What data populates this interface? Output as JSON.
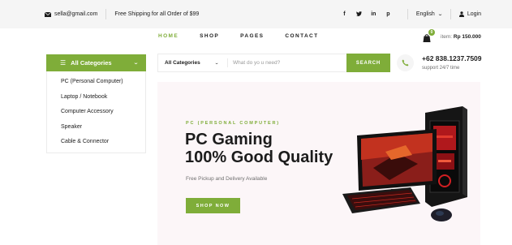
{
  "topbar": {
    "email": "sella@gmail.com",
    "shipping": "Free Shipping for all Order of $99",
    "social": [
      "f",
      "t",
      "in",
      "p"
    ],
    "language": "English",
    "login": "Login"
  },
  "nav": {
    "items": [
      "HOME",
      "SHOP",
      "PAGES",
      "CONTACT"
    ],
    "active": "HOME"
  },
  "cart": {
    "badge": "0",
    "label": "item:",
    "total": "Rp 150.000"
  },
  "categories": {
    "button_label": "All Categories",
    "items": [
      "PC (Personal Computer)",
      "Laptop / Notebook",
      "Computer Accessory",
      "Speaker",
      "Cable & Connector"
    ]
  },
  "search": {
    "select_value": "All Categories",
    "placeholder": "What do yo u need?",
    "button_label": "SEARCH"
  },
  "contact": {
    "phone": "+62 838.1237.7509",
    "support": "support 24/7 time"
  },
  "hero": {
    "kicker": "PC (PERSONAL COMPUTER)",
    "title_line1": "PC Gaming",
    "title_line2": "100% Good Quality",
    "subtitle": "Free Pickup and Delivery Available",
    "button_label": "SHOP NOW"
  },
  "colors": {
    "accent": "#7fad39",
    "topbar_bg": "#f5f5f5",
    "hero_bg": "#fcf6f8",
    "text": "#1c1c1c"
  },
  "icons": [
    "envelope-icon",
    "facebook-icon",
    "twitter-icon",
    "linkedin-icon",
    "pinterest-icon",
    "user-icon",
    "cart-icon",
    "bars-icon",
    "chevron-down-icon",
    "phone-icon"
  ]
}
